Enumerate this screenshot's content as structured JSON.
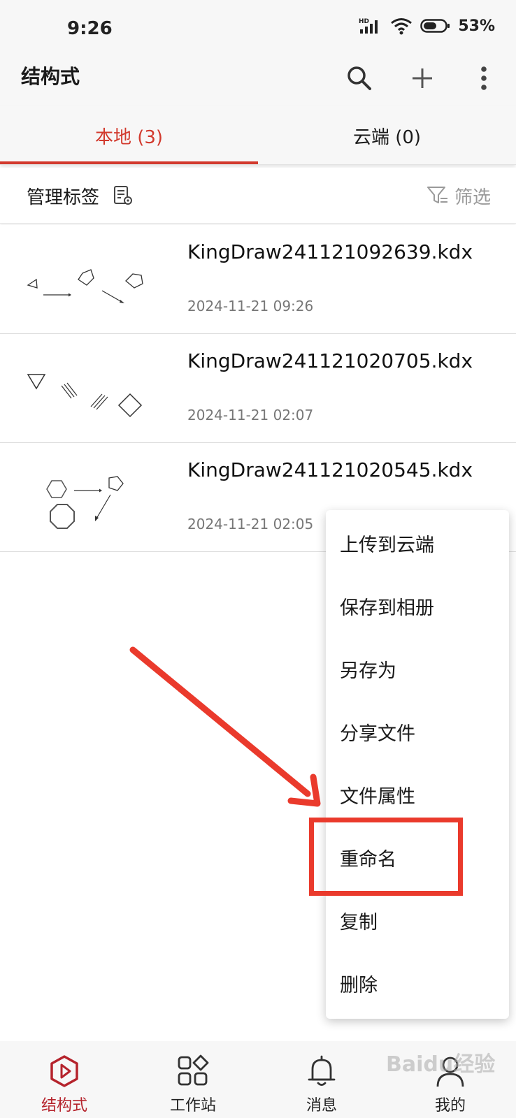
{
  "status_bar": {
    "time": "9:26",
    "hd_badge": "HD",
    "battery_percent": "53%"
  },
  "app_bar": {
    "title": "结构式",
    "search_icon": "search-icon",
    "add_icon": "plus-icon",
    "more_icon": "more-vertical-icon"
  },
  "tabs": [
    {
      "label": "本地 (3)",
      "active": true
    },
    {
      "label": "云端 (0)",
      "active": false
    }
  ],
  "toolbar": {
    "manage_tags_label": "管理标签",
    "filter_label": "筛选"
  },
  "files": [
    {
      "name": "KingDraw241121092639.kdx",
      "date": "2024-11-21 09:26"
    },
    {
      "name": "KingDraw241121020705.kdx",
      "date": "2024-11-21 02:07"
    },
    {
      "name": "KingDraw241121020545.kdx",
      "date": "2024-11-21 02:05"
    }
  ],
  "context_menu": {
    "items": [
      "上传到云端",
      "保存到相册",
      "另存为",
      "分享文件",
      "文件属性",
      "重命名",
      "复制",
      "删除"
    ],
    "highlighted": "重命名"
  },
  "bottom_nav": [
    {
      "label": "结构式",
      "icon": "structure-icon",
      "active": true
    },
    {
      "label": "工作站",
      "icon": "workstation-icon",
      "active": false
    },
    {
      "label": "消息",
      "icon": "bell-icon",
      "active": false
    },
    {
      "label": "我的",
      "icon": "user-icon",
      "active": false
    }
  ],
  "watermark": "Baidu经验",
  "colors": {
    "accent": "#d23a2e",
    "annotation": "#ea3a2c",
    "nav_active": "#b5232c"
  }
}
